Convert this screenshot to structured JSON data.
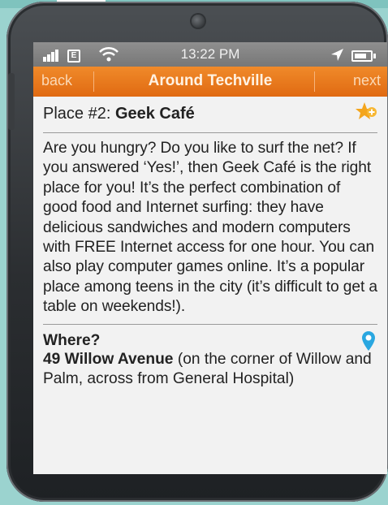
{
  "status_bar": {
    "time": "13:22 PM",
    "network_letter": "E"
  },
  "nav": {
    "back_label": "back",
    "title": "Around Techville",
    "next_label": "next"
  },
  "place": {
    "title_prefix": "Place #2: ",
    "title_name": "Geek Café",
    "description": "Are you hungry? Do you like to surf the net? If you answered ‘Yes!’, then Geek Café is the right place for you! It’s the perfect combination of good food and Internet surfing: they have delicious sandwiches and modern computers with FREE Internet access for one hour. You can also play computer games online. It’s a popular place among teens in the city (it’s difficult to get a table on weekends!).",
    "where_label": "Where?",
    "address": "49 Willow Avenue",
    "address_detail": " (on the corner of Willow and Palm, across from General Hospital)"
  },
  "colors": {
    "accent": "#e8781c",
    "pin": "#2aa7e0",
    "star": "#f4a51c"
  },
  "icons": {
    "signal": "signal-icon",
    "wifi": "wifi-icon",
    "location": "location-arrow-icon",
    "battery": "battery-icon",
    "star": "star-add-icon",
    "pin": "map-pin-icon"
  }
}
